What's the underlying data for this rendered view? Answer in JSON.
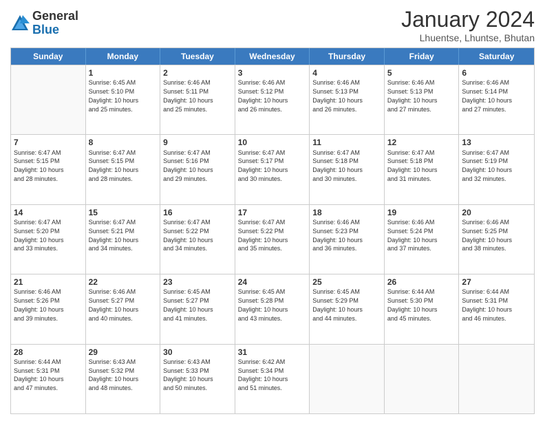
{
  "logo": {
    "general": "General",
    "blue": "Blue"
  },
  "title": "January 2024",
  "subtitle": "Lhuentse, Lhuntse, Bhutan",
  "header_days": [
    "Sunday",
    "Monday",
    "Tuesday",
    "Wednesday",
    "Thursday",
    "Friday",
    "Saturday"
  ],
  "weeks": [
    [
      {
        "day": "",
        "info": ""
      },
      {
        "day": "1",
        "info": "Sunrise: 6:45 AM\nSunset: 5:10 PM\nDaylight: 10 hours\nand 25 minutes."
      },
      {
        "day": "2",
        "info": "Sunrise: 6:46 AM\nSunset: 5:11 PM\nDaylight: 10 hours\nand 25 minutes."
      },
      {
        "day": "3",
        "info": "Sunrise: 6:46 AM\nSunset: 5:12 PM\nDaylight: 10 hours\nand 26 minutes."
      },
      {
        "day": "4",
        "info": "Sunrise: 6:46 AM\nSunset: 5:13 PM\nDaylight: 10 hours\nand 26 minutes."
      },
      {
        "day": "5",
        "info": "Sunrise: 6:46 AM\nSunset: 5:13 PM\nDaylight: 10 hours\nand 27 minutes."
      },
      {
        "day": "6",
        "info": "Sunrise: 6:46 AM\nSunset: 5:14 PM\nDaylight: 10 hours\nand 27 minutes."
      }
    ],
    [
      {
        "day": "7",
        "info": "Sunrise: 6:47 AM\nSunset: 5:15 PM\nDaylight: 10 hours\nand 28 minutes."
      },
      {
        "day": "8",
        "info": "Sunrise: 6:47 AM\nSunset: 5:15 PM\nDaylight: 10 hours\nand 28 minutes."
      },
      {
        "day": "9",
        "info": "Sunrise: 6:47 AM\nSunset: 5:16 PM\nDaylight: 10 hours\nand 29 minutes."
      },
      {
        "day": "10",
        "info": "Sunrise: 6:47 AM\nSunset: 5:17 PM\nDaylight: 10 hours\nand 30 minutes."
      },
      {
        "day": "11",
        "info": "Sunrise: 6:47 AM\nSunset: 5:18 PM\nDaylight: 10 hours\nand 30 minutes."
      },
      {
        "day": "12",
        "info": "Sunrise: 6:47 AM\nSunset: 5:18 PM\nDaylight: 10 hours\nand 31 minutes."
      },
      {
        "day": "13",
        "info": "Sunrise: 6:47 AM\nSunset: 5:19 PM\nDaylight: 10 hours\nand 32 minutes."
      }
    ],
    [
      {
        "day": "14",
        "info": "Sunrise: 6:47 AM\nSunset: 5:20 PM\nDaylight: 10 hours\nand 33 minutes."
      },
      {
        "day": "15",
        "info": "Sunrise: 6:47 AM\nSunset: 5:21 PM\nDaylight: 10 hours\nand 34 minutes."
      },
      {
        "day": "16",
        "info": "Sunrise: 6:47 AM\nSunset: 5:22 PM\nDaylight: 10 hours\nand 34 minutes."
      },
      {
        "day": "17",
        "info": "Sunrise: 6:47 AM\nSunset: 5:22 PM\nDaylight: 10 hours\nand 35 minutes."
      },
      {
        "day": "18",
        "info": "Sunrise: 6:46 AM\nSunset: 5:23 PM\nDaylight: 10 hours\nand 36 minutes."
      },
      {
        "day": "19",
        "info": "Sunrise: 6:46 AM\nSunset: 5:24 PM\nDaylight: 10 hours\nand 37 minutes."
      },
      {
        "day": "20",
        "info": "Sunrise: 6:46 AM\nSunset: 5:25 PM\nDaylight: 10 hours\nand 38 minutes."
      }
    ],
    [
      {
        "day": "21",
        "info": "Sunrise: 6:46 AM\nSunset: 5:26 PM\nDaylight: 10 hours\nand 39 minutes."
      },
      {
        "day": "22",
        "info": "Sunrise: 6:46 AM\nSunset: 5:27 PM\nDaylight: 10 hours\nand 40 minutes."
      },
      {
        "day": "23",
        "info": "Sunrise: 6:45 AM\nSunset: 5:27 PM\nDaylight: 10 hours\nand 41 minutes."
      },
      {
        "day": "24",
        "info": "Sunrise: 6:45 AM\nSunset: 5:28 PM\nDaylight: 10 hours\nand 43 minutes."
      },
      {
        "day": "25",
        "info": "Sunrise: 6:45 AM\nSunset: 5:29 PM\nDaylight: 10 hours\nand 44 minutes."
      },
      {
        "day": "26",
        "info": "Sunrise: 6:44 AM\nSunset: 5:30 PM\nDaylight: 10 hours\nand 45 minutes."
      },
      {
        "day": "27",
        "info": "Sunrise: 6:44 AM\nSunset: 5:31 PM\nDaylight: 10 hours\nand 46 minutes."
      }
    ],
    [
      {
        "day": "28",
        "info": "Sunrise: 6:44 AM\nSunset: 5:31 PM\nDaylight: 10 hours\nand 47 minutes."
      },
      {
        "day": "29",
        "info": "Sunrise: 6:43 AM\nSunset: 5:32 PM\nDaylight: 10 hours\nand 48 minutes."
      },
      {
        "day": "30",
        "info": "Sunrise: 6:43 AM\nSunset: 5:33 PM\nDaylight: 10 hours\nand 50 minutes."
      },
      {
        "day": "31",
        "info": "Sunrise: 6:42 AM\nSunset: 5:34 PM\nDaylight: 10 hours\nand 51 minutes."
      },
      {
        "day": "",
        "info": ""
      },
      {
        "day": "",
        "info": ""
      },
      {
        "day": "",
        "info": ""
      }
    ]
  ]
}
